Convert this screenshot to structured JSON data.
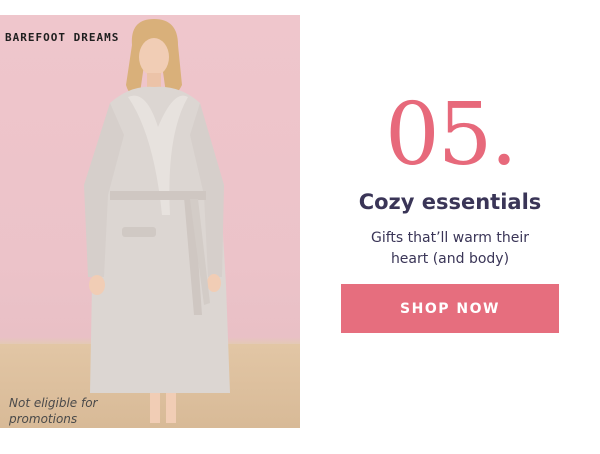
{
  "promo": {
    "brand_logo_text": "BAREFOOT DREAMS",
    "notice": "Not eligible for promotions",
    "number": "05.",
    "title": "Cozy essentials",
    "subtitle_line1": "Gifts that’ll warm their",
    "subtitle_line2": "heart (and body)",
    "cta_label": "SHOP NOW"
  },
  "colors": {
    "accent": "#e66e7e",
    "number_color": "#e7697b",
    "text_dark": "#3a3557",
    "photo_background": "#efc6cc"
  }
}
